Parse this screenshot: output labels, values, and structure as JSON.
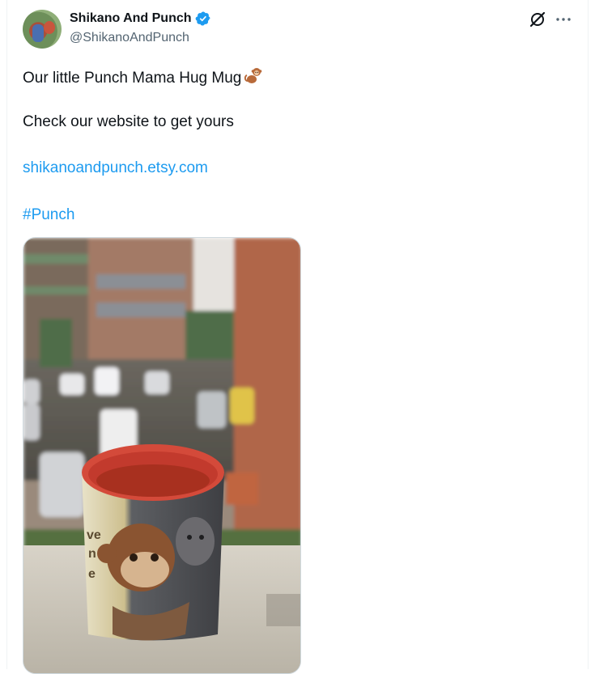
{
  "post": {
    "author_name": "Shikano And Punch",
    "author_handle": "@ShikanoAndPunch",
    "text_line_1": "Our little Punch Mama Hug Mug",
    "text_line_2": "Check our website to get yours",
    "link_text": "shikanoandpunch.etsy.com",
    "hashtag": "#Punch"
  },
  "icons": {
    "verified": "verified-badge-icon",
    "grok": "grok-icon",
    "more": "more-icon",
    "emoji": "monkey-emoji"
  },
  "colors": {
    "accent": "#1d9bf0",
    "text": "#0f1419",
    "muted": "#536471"
  }
}
